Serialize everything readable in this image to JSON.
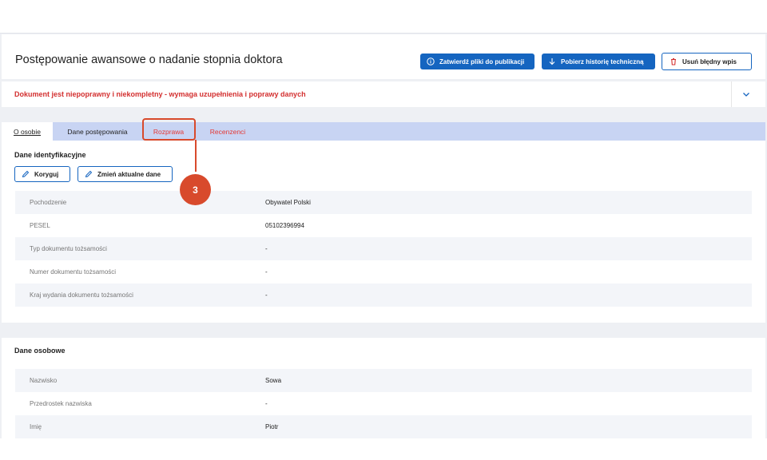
{
  "header": {
    "title": "Postępowanie awansowe o nadanie stopnia doktora",
    "buttons": {
      "approve": "Zatwierdź pliki do publikacji",
      "download_history": "Pobierz historię techniczną",
      "delete": "Usuń błędny wpis"
    }
  },
  "alert": {
    "text": "Dokument jest niepoprawny i niekompletny - wymaga uzupełnienia i poprawy danych"
  },
  "tabs": [
    {
      "label": "O osobie",
      "state": "active"
    },
    {
      "label": "Dane postępowania",
      "state": "normal"
    },
    {
      "label": "Rozprawa",
      "state": "error"
    },
    {
      "label": "Recenzenci",
      "state": "error"
    }
  ],
  "callout": {
    "number": "3"
  },
  "identification": {
    "title": "Dane identyfikacyjne",
    "buttons": {
      "correct": "Koryguj",
      "change": "Zmień aktualne dane"
    },
    "rows": [
      {
        "label": "Pochodzenie",
        "value": "Obywatel Polski"
      },
      {
        "label": "PESEL",
        "value": "05102396994"
      },
      {
        "label": "Typ dokumentu tożsamości",
        "value": "-"
      },
      {
        "label": "Numer dokumentu tożsamości",
        "value": "-"
      },
      {
        "label": "Kraj wydania dokumentu tożsamości",
        "value": "-"
      }
    ]
  },
  "personal": {
    "title": "Dane osobowe",
    "rows": [
      {
        "label": "Nazwisko",
        "value": "Sowa"
      },
      {
        "label": "Przedrostek nazwiska",
        "value": "-"
      },
      {
        "label": "Imię",
        "value": "Piotr"
      }
    ]
  },
  "colors": {
    "primary": "#1565c0",
    "error": "#d32f2f",
    "callout": "#d84a2c",
    "tabbar": "#c8d4f3"
  }
}
